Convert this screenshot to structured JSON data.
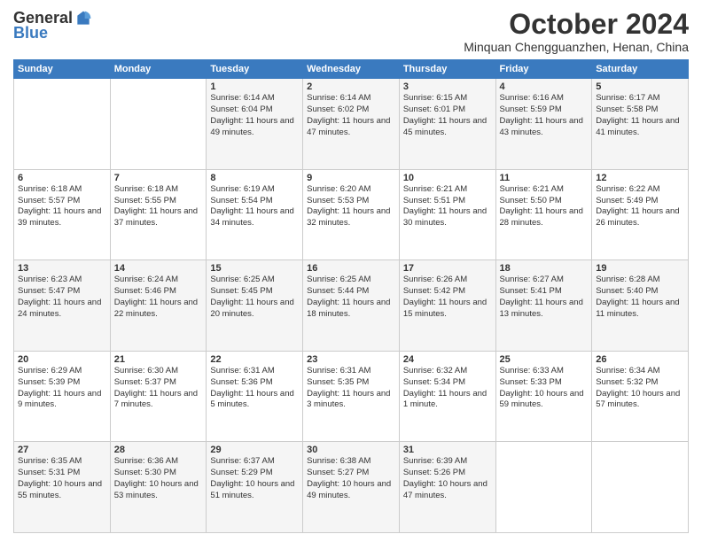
{
  "logo": {
    "general": "General",
    "blue": "Blue"
  },
  "title": "October 2024",
  "location": "Minquan Chengguanzhen, Henan, China",
  "days_of_week": [
    "Sunday",
    "Monday",
    "Tuesday",
    "Wednesday",
    "Thursday",
    "Friday",
    "Saturday"
  ],
  "weeks": [
    [
      {
        "day": "",
        "content": ""
      },
      {
        "day": "",
        "content": ""
      },
      {
        "day": "1",
        "content": "Sunrise: 6:14 AM\nSunset: 6:04 PM\nDaylight: 11 hours and 49 minutes."
      },
      {
        "day": "2",
        "content": "Sunrise: 6:14 AM\nSunset: 6:02 PM\nDaylight: 11 hours and 47 minutes."
      },
      {
        "day": "3",
        "content": "Sunrise: 6:15 AM\nSunset: 6:01 PM\nDaylight: 11 hours and 45 minutes."
      },
      {
        "day": "4",
        "content": "Sunrise: 6:16 AM\nSunset: 5:59 PM\nDaylight: 11 hours and 43 minutes."
      },
      {
        "day": "5",
        "content": "Sunrise: 6:17 AM\nSunset: 5:58 PM\nDaylight: 11 hours and 41 minutes."
      }
    ],
    [
      {
        "day": "6",
        "content": "Sunrise: 6:18 AM\nSunset: 5:57 PM\nDaylight: 11 hours and 39 minutes."
      },
      {
        "day": "7",
        "content": "Sunrise: 6:18 AM\nSunset: 5:55 PM\nDaylight: 11 hours and 37 minutes."
      },
      {
        "day": "8",
        "content": "Sunrise: 6:19 AM\nSunset: 5:54 PM\nDaylight: 11 hours and 34 minutes."
      },
      {
        "day": "9",
        "content": "Sunrise: 6:20 AM\nSunset: 5:53 PM\nDaylight: 11 hours and 32 minutes."
      },
      {
        "day": "10",
        "content": "Sunrise: 6:21 AM\nSunset: 5:51 PM\nDaylight: 11 hours and 30 minutes."
      },
      {
        "day": "11",
        "content": "Sunrise: 6:21 AM\nSunset: 5:50 PM\nDaylight: 11 hours and 28 minutes."
      },
      {
        "day": "12",
        "content": "Sunrise: 6:22 AM\nSunset: 5:49 PM\nDaylight: 11 hours and 26 minutes."
      }
    ],
    [
      {
        "day": "13",
        "content": "Sunrise: 6:23 AM\nSunset: 5:47 PM\nDaylight: 11 hours and 24 minutes."
      },
      {
        "day": "14",
        "content": "Sunrise: 6:24 AM\nSunset: 5:46 PM\nDaylight: 11 hours and 22 minutes."
      },
      {
        "day": "15",
        "content": "Sunrise: 6:25 AM\nSunset: 5:45 PM\nDaylight: 11 hours and 20 minutes."
      },
      {
        "day": "16",
        "content": "Sunrise: 6:25 AM\nSunset: 5:44 PM\nDaylight: 11 hours and 18 minutes."
      },
      {
        "day": "17",
        "content": "Sunrise: 6:26 AM\nSunset: 5:42 PM\nDaylight: 11 hours and 15 minutes."
      },
      {
        "day": "18",
        "content": "Sunrise: 6:27 AM\nSunset: 5:41 PM\nDaylight: 11 hours and 13 minutes."
      },
      {
        "day": "19",
        "content": "Sunrise: 6:28 AM\nSunset: 5:40 PM\nDaylight: 11 hours and 11 minutes."
      }
    ],
    [
      {
        "day": "20",
        "content": "Sunrise: 6:29 AM\nSunset: 5:39 PM\nDaylight: 11 hours and 9 minutes."
      },
      {
        "day": "21",
        "content": "Sunrise: 6:30 AM\nSunset: 5:37 PM\nDaylight: 11 hours and 7 minutes."
      },
      {
        "day": "22",
        "content": "Sunrise: 6:31 AM\nSunset: 5:36 PM\nDaylight: 11 hours and 5 minutes."
      },
      {
        "day": "23",
        "content": "Sunrise: 6:31 AM\nSunset: 5:35 PM\nDaylight: 11 hours and 3 minutes."
      },
      {
        "day": "24",
        "content": "Sunrise: 6:32 AM\nSunset: 5:34 PM\nDaylight: 11 hours and 1 minute."
      },
      {
        "day": "25",
        "content": "Sunrise: 6:33 AM\nSunset: 5:33 PM\nDaylight: 10 hours and 59 minutes."
      },
      {
        "day": "26",
        "content": "Sunrise: 6:34 AM\nSunset: 5:32 PM\nDaylight: 10 hours and 57 minutes."
      }
    ],
    [
      {
        "day": "27",
        "content": "Sunrise: 6:35 AM\nSunset: 5:31 PM\nDaylight: 10 hours and 55 minutes."
      },
      {
        "day": "28",
        "content": "Sunrise: 6:36 AM\nSunset: 5:30 PM\nDaylight: 10 hours and 53 minutes."
      },
      {
        "day": "29",
        "content": "Sunrise: 6:37 AM\nSunset: 5:29 PM\nDaylight: 10 hours and 51 minutes."
      },
      {
        "day": "30",
        "content": "Sunrise: 6:38 AM\nSunset: 5:27 PM\nDaylight: 10 hours and 49 minutes."
      },
      {
        "day": "31",
        "content": "Sunrise: 6:39 AM\nSunset: 5:26 PM\nDaylight: 10 hours and 47 minutes."
      },
      {
        "day": "",
        "content": ""
      },
      {
        "day": "",
        "content": ""
      }
    ]
  ]
}
